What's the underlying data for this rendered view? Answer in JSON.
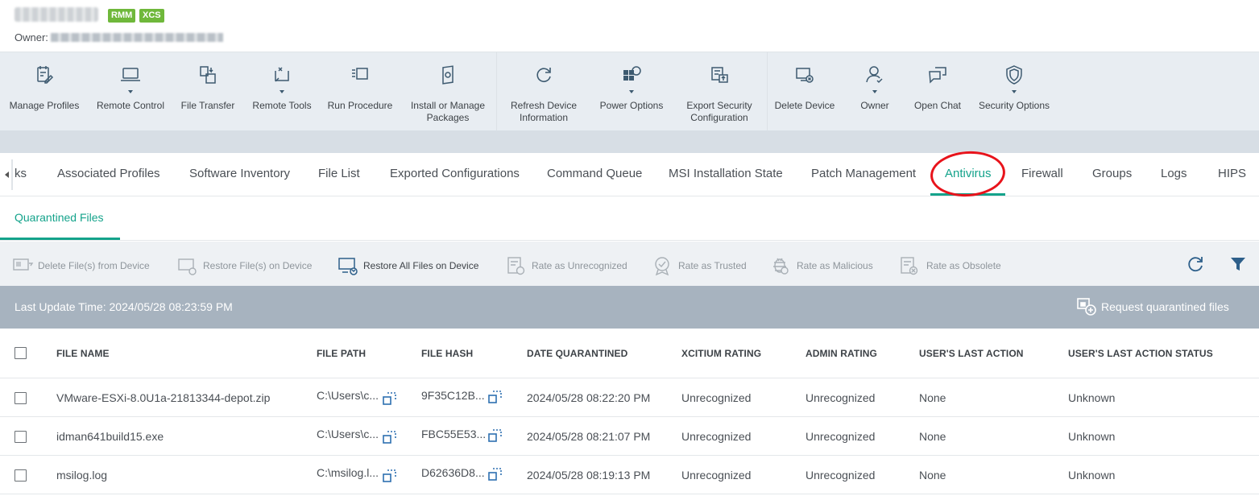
{
  "device": {
    "name": "Pqrsbdfs11",
    "badges": [
      "RMM",
      "XCS"
    ],
    "owner_label": "Owner:",
    "owner_value": "cnrnbdpnnnjpd@ypnndt.com"
  },
  "toolbar": {
    "items": [
      {
        "label": "Manage Profiles",
        "icon": "manage-profiles-icon",
        "dropdown": false
      },
      {
        "label": "Remote Control",
        "icon": "laptop-icon",
        "dropdown": true
      },
      {
        "label": "File Transfer",
        "icon": "file-transfer-icon",
        "dropdown": false
      },
      {
        "label": "Remote Tools",
        "icon": "remote-tools-icon",
        "dropdown": true
      },
      {
        "label": "Run Procedure",
        "icon": "run-procedure-icon",
        "dropdown": false
      },
      {
        "label": "Install or Manage\nPackages",
        "icon": "package-icon",
        "dropdown": false
      },
      {
        "label": "Refresh Device\nInformation",
        "icon": "refresh-icon",
        "dropdown": false
      },
      {
        "label": "Power Options",
        "icon": "power-options-icon",
        "dropdown": true
      },
      {
        "label": "Export Security\nConfiguration",
        "icon": "export-config-icon",
        "dropdown": false
      },
      {
        "label": "Delete Device",
        "icon": "delete-device-icon",
        "dropdown": false
      },
      {
        "label": "Owner",
        "icon": "owner-icon",
        "dropdown": true
      },
      {
        "label": "Open Chat",
        "icon": "chat-icon",
        "dropdown": false
      },
      {
        "label": "Security Options",
        "icon": "shield-icon",
        "dropdown": true
      }
    ]
  },
  "tabs": {
    "items": [
      "ks",
      "Associated Profiles",
      "Software Inventory",
      "File List",
      "Exported Configurations",
      "Command Queue",
      "MSI Installation State",
      "Patch Management",
      "Antivirus",
      "Firewall",
      "Groups",
      "Logs",
      "HIPS"
    ],
    "active": "Antivirus"
  },
  "subtabs": {
    "active": "Quarantined Files"
  },
  "actions": {
    "items": [
      {
        "label": "Delete File(s) from Device",
        "enabled": false,
        "icon": "delete-file-icon"
      },
      {
        "label": "Restore File(s) on Device",
        "enabled": false,
        "icon": "restore-file-icon"
      },
      {
        "label": "Restore All Files on Device",
        "enabled": true,
        "icon": "restore-all-icon"
      },
      {
        "label": "Rate as Unrecognized",
        "enabled": false,
        "icon": "rate-unrecognized-icon"
      },
      {
        "label": "Rate as Trusted",
        "enabled": false,
        "icon": "rate-trusted-icon"
      },
      {
        "label": "Rate as Malicious",
        "enabled": false,
        "icon": "rate-malicious-icon"
      },
      {
        "label": "Rate as Obsolete",
        "enabled": false,
        "icon": "rate-obsolete-icon"
      }
    ]
  },
  "infobar": {
    "last_update": "Last Update Time: 2024/05/28 08:23:59 PM",
    "request_label": "Request quarantined files"
  },
  "table": {
    "columns": [
      "FILE NAME",
      "FILE PATH",
      "FILE HASH",
      "DATE QUARANTINED",
      "XCITIUM RATING",
      "ADMIN RATING",
      "USER'S LAST ACTION",
      "USER'S LAST ACTION STATUS"
    ],
    "rows": [
      {
        "name": "VMware-ESXi-8.0U1a-21813344-depot.zip",
        "path": "C:\\Users\\c...",
        "hash": "9F35C12B...",
        "date": "2024/05/28 08:22:20 PM",
        "xcitium": "Unrecognized",
        "admin": "Unrecognized",
        "action": "None",
        "status": "Unknown"
      },
      {
        "name": "idman641build15.exe",
        "path": "C:\\Users\\c...",
        "hash": "FBC55E53...",
        "date": "2024/05/28 08:21:07 PM",
        "xcitium": "Unrecognized",
        "admin": "Unrecognized",
        "action": "None",
        "status": "Unknown"
      },
      {
        "name": "msilog.log",
        "path": "C:\\msilog.l...",
        "hash": "D62636D8...",
        "date": "2024/05/28 08:19:13 PM",
        "xcitium": "Unrecognized",
        "admin": "Unrecognized",
        "action": "None",
        "status": "Unknown"
      }
    ]
  },
  "colors": {
    "accent": "#14a38b",
    "badge": "#6fb83b",
    "annotation": "#e8131b",
    "infobar": "#a7b3bf"
  }
}
